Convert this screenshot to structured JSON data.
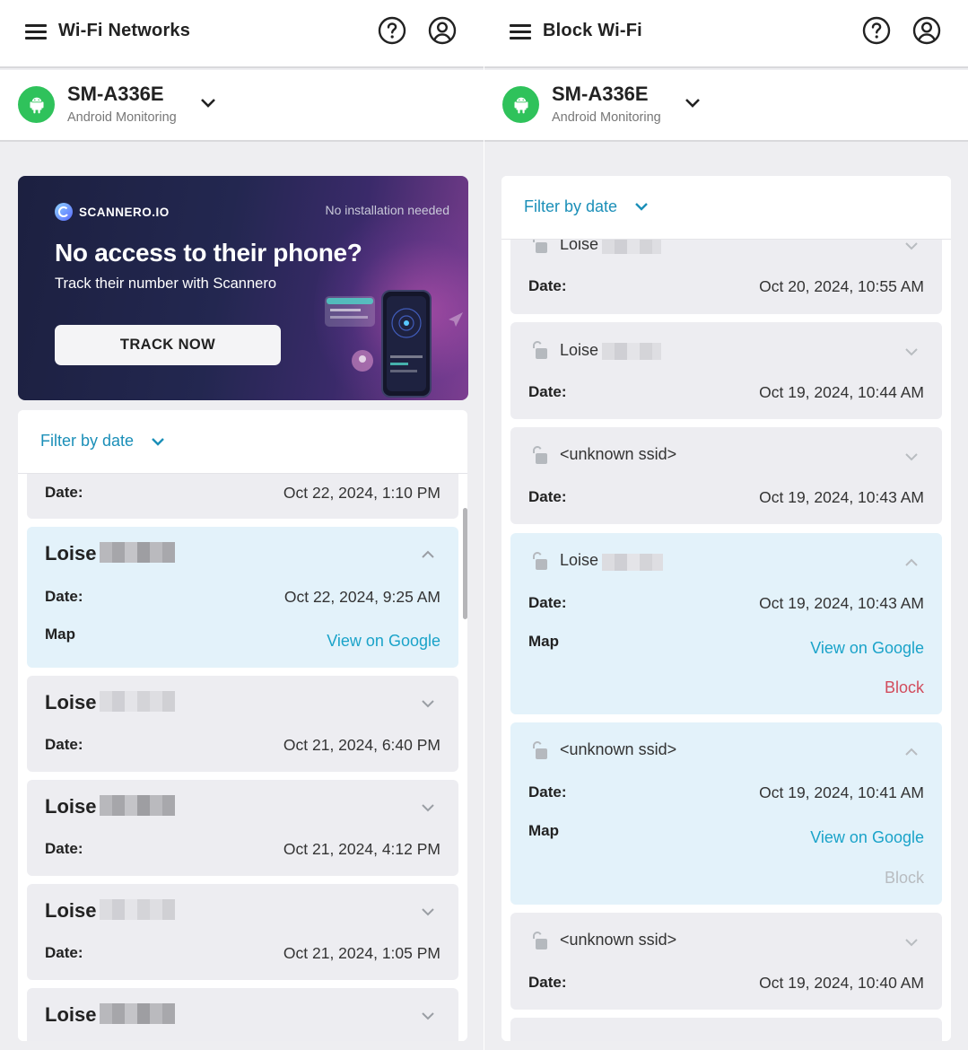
{
  "left": {
    "header": {
      "title": "Wi-Fi Networks"
    },
    "device": {
      "name": "SM-A336E",
      "subtitle": "Android Monitoring"
    },
    "banner": {
      "brand": "SCANNERO.IO",
      "note": "No installation needed",
      "title": "No access to their phone?",
      "subtitle": "Track their number with Scannero",
      "button": "TRACK NOW"
    },
    "filter": {
      "label": "Filter by date"
    },
    "labels": {
      "date": "Date:",
      "map": "Map",
      "view": "View on Google"
    },
    "entries": [
      {
        "ssid": "",
        "date": "Oct 22, 2024, 1:10 PM",
        "expanded": false
      },
      {
        "ssid": "Loise",
        "date": "Oct 22, 2024, 9:25 AM",
        "expanded": true
      },
      {
        "ssid": "Loise",
        "date": "Oct 21, 2024, 6:40 PM",
        "expanded": false
      },
      {
        "ssid": "Loise",
        "date": "Oct 21, 2024, 4:12 PM",
        "expanded": false
      },
      {
        "ssid": "Loise",
        "date": "Oct 21, 2024, 1:05 PM",
        "expanded": false
      },
      {
        "ssid": "Loise",
        "date": "",
        "expanded": false
      }
    ]
  },
  "right": {
    "header": {
      "title": "Block Wi-Fi"
    },
    "device": {
      "name": "SM-A336E",
      "subtitle": "Android Monitoring"
    },
    "filter": {
      "label": "Filter by date"
    },
    "labels": {
      "date": "Date:",
      "map": "Map",
      "view": "View on Google",
      "block": "Block"
    },
    "entries": [
      {
        "ssid": "Loise",
        "date": "Oct 20, 2024, 10:55 AM",
        "expanded": false
      },
      {
        "ssid": "Loise",
        "date": "Oct 19, 2024, 10:44 AM",
        "expanded": false
      },
      {
        "ssid": "<unknown ssid>",
        "date": "Oct 19, 2024, 10:43 AM",
        "expanded": false
      },
      {
        "ssid": "Loise",
        "date": "Oct 19, 2024, 10:43 AM",
        "expanded": true,
        "block_enabled": true
      },
      {
        "ssid": "<unknown ssid>",
        "date": "Oct 19, 2024, 10:41 AM",
        "expanded": true,
        "block_enabled": false
      },
      {
        "ssid": "<unknown ssid>",
        "date": "Oct 19, 2024, 10:40 AM",
        "expanded": false
      }
    ]
  },
  "colors": {
    "accent": "#1b8fb8",
    "link": "#1aa3c9",
    "block_active": "#d24c5c",
    "block_disabled": "#b8bcc0",
    "android_green": "#2fc25b",
    "expanded_bg": "#e3f2fa",
    "entry_bg": "#ededf1"
  },
  "icons": [
    "menu-icon",
    "help-icon",
    "account-icon",
    "android-icon",
    "chevron-down-icon",
    "chevron-up-icon",
    "unlock-icon",
    "scannero-logo-icon"
  ]
}
